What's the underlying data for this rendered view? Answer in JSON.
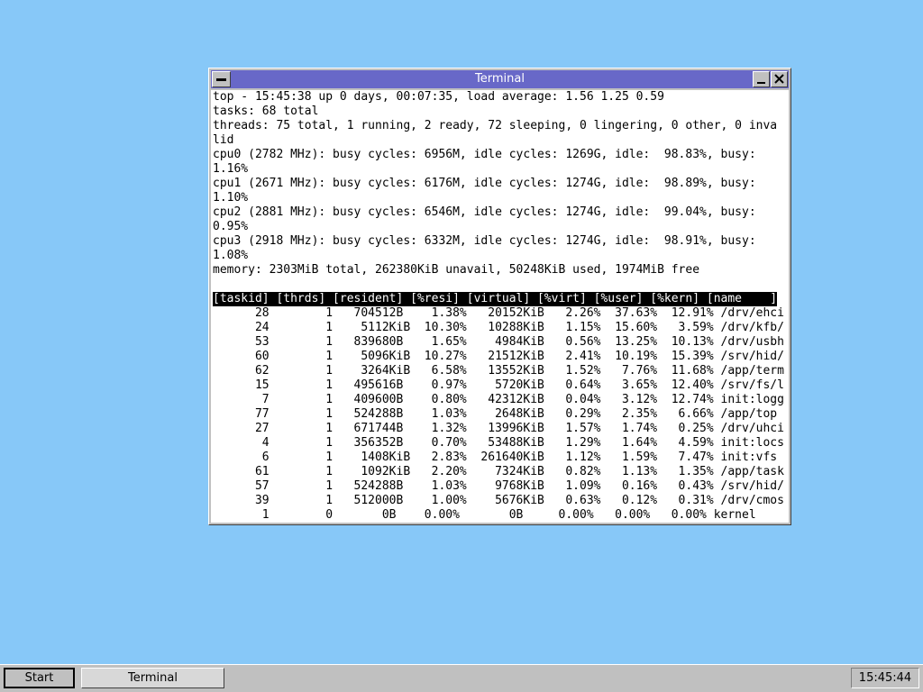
{
  "window": {
    "title": "Terminal"
  },
  "terminal": {
    "lines": [
      "top - 15:45:38 up 0 days, 00:07:35, load average: 1.56 1.25 0.59",
      "tasks: 68 total",
      "threads: 75 total, 1 running, 2 ready, 72 sleeping, 0 lingering, 0 other, 0 inva",
      "lid",
      "cpu0 (2782 MHz): busy cycles: 6956M, idle cycles: 1269G, idle:  98.83%, busy:",
      "1.16%",
      "cpu1 (2671 MHz): busy cycles: 6176M, idle cycles: 1274G, idle:  98.89%, busy:",
      "1.10%",
      "cpu2 (2881 MHz): busy cycles: 6546M, idle cycles: 1274G, idle:  99.04%, busy:",
      "0.95%",
      "cpu3 (2918 MHz): busy cycles: 6332M, idle cycles: 1274G, idle:  98.91%, busy:",
      "1.08%",
      "memory: 2303MiB total, 262380KiB unavail, 50248KiB used, 1974MiB free",
      "",
      "[taskid] [thrds] [resident] [%resi] [virtual] [%virt] [%user] [%kern] [name    ]",
      "      28        1   704512B    1.38%   20152KiB   2.26%  37.63%  12.91% /drv/ehci",
      "      24        1    5112KiB  10.30%   10288KiB   1.15%  15.60%   3.59% /drv/kfb/",
      "      53        1   839680B    1.65%    4984KiB   0.56%  13.25%  10.13% /drv/usbh",
      "      60        1    5096KiB  10.27%   21512KiB   2.41%  10.19%  15.39% /srv/hid/",
      "      62        1    3264KiB   6.58%   13552KiB   1.52%   7.76%  11.68% /app/term",
      "      15        1   495616B    0.97%    5720KiB   0.64%   3.65%  12.40% /srv/fs/l",
      "       7        1   409600B    0.80%   42312KiB   0.04%   3.12%  12.74% init:logg",
      "      77        1   524288B    1.03%    2648KiB   0.29%   2.35%   6.66% /app/top",
      "      27        1   671744B    1.32%   13996KiB   1.57%   1.74%   0.25% /drv/uhci",
      "       4        1   356352B    0.70%   53488KiB   1.29%   1.64%   4.59% init:locs",
      "       6        1    1408KiB   2.83%  261640KiB   1.12%   1.59%   7.47% init:vfs",
      "      61        1    1092KiB   2.20%    7324KiB   0.82%   1.13%   1.35% /app/task",
      "      57        1   524288B    1.03%    9768KiB   1.09%   0.16%   0.43% /srv/hid/",
      "      39        1   512000B    1.00%    5676KiB   0.63%   0.12%   0.31% /drv/cmos",
      "       1        0       0B    0.00%       0B     0.00%   0.00%   0.00% kernel"
    ]
  },
  "taskbar": {
    "start_label": "Start",
    "task_label": "Terminal",
    "clock": "15:45:44"
  }
}
